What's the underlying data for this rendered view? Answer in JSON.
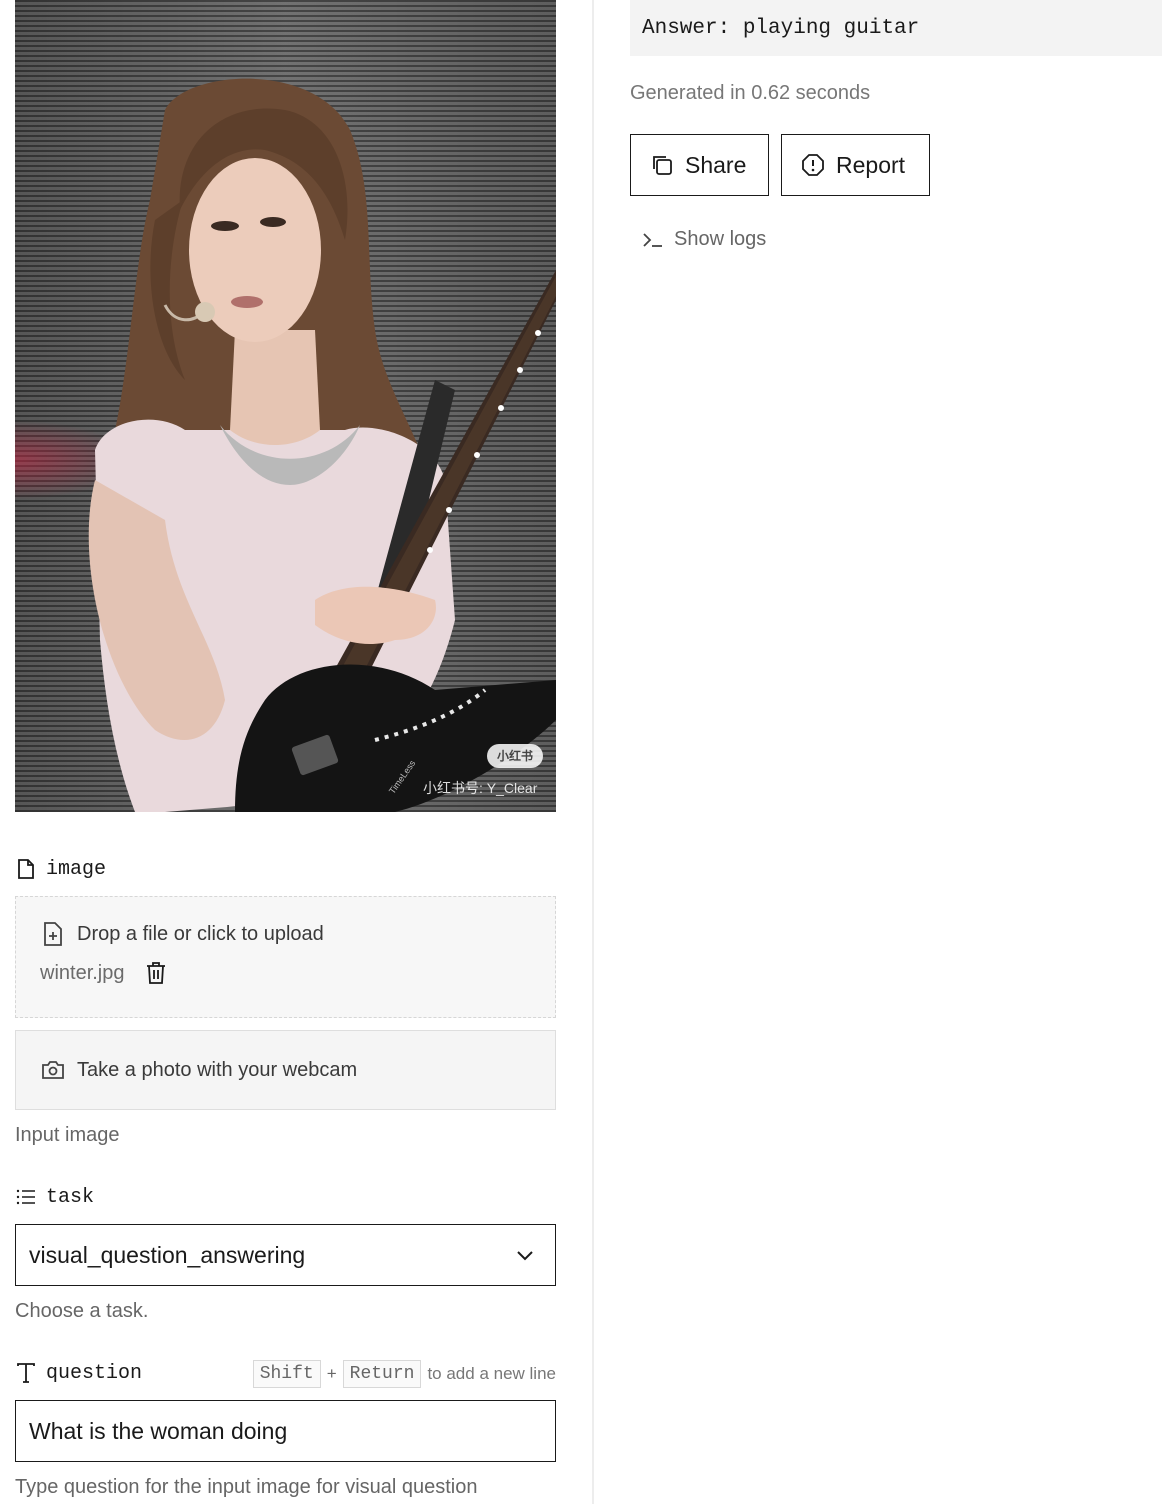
{
  "inputs": {
    "image_field": {
      "label": "image",
      "icon": "file-icon",
      "upload_prompt": "Drop a file or click to upload",
      "filename": "winter.jpg",
      "webcam_label": "Take a photo with your webcam",
      "help": "Input image",
      "watermark": {
        "badge": "小红书",
        "text": "小红书号: Y_Clear",
        "small": "TimeLess"
      }
    },
    "task_field": {
      "label": "task",
      "icon": "list-icon",
      "selected": "visual_question_answering",
      "help": "Choose a task."
    },
    "question_field": {
      "label": "question",
      "icon": "text-icon",
      "shortcut": {
        "key1": "Shift",
        "plus": "+",
        "key2": "Return",
        "text": "to add a new line"
      },
      "value": "What is the woman doing",
      "help": "Type question for the input image for visual question"
    }
  },
  "output": {
    "answer": "Answer: playing guitar",
    "generated": "Generated in 0.62 seconds",
    "share_label": "Share",
    "report_label": "Report",
    "logs_label": "Show logs"
  },
  "colors": {
    "border": "#1a1a1a",
    "muted_text": "#666666",
    "panel_bg": "#f3f3f3"
  }
}
